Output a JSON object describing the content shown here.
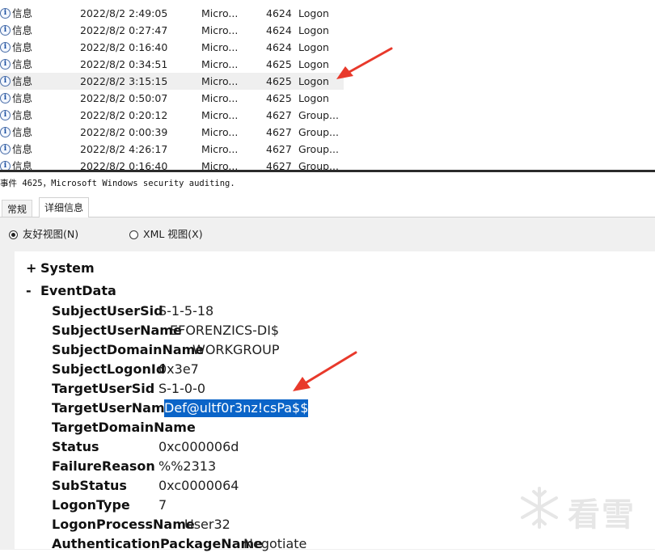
{
  "events": [
    {
      "level": "信息",
      "date": "2022/8/2 2:49:05",
      "source": "Micro...",
      "event_id": "4624",
      "task": "Logon"
    },
    {
      "level": "信息",
      "date": "2022/8/2 0:27:47",
      "source": "Micro...",
      "event_id": "4624",
      "task": "Logon"
    },
    {
      "level": "信息",
      "date": "2022/8/2 0:16:40",
      "source": "Micro...",
      "event_id": "4624",
      "task": "Logon"
    },
    {
      "level": "信息",
      "date": "2022/8/2 0:34:51",
      "source": "Micro...",
      "event_id": "4625",
      "task": "Logon"
    },
    {
      "level": "信息",
      "date": "2022/8/2 3:15:15",
      "source": "Micro...",
      "event_id": "4625",
      "task": "Logon",
      "selected": true
    },
    {
      "level": "信息",
      "date": "2022/8/2 0:50:07",
      "source": "Micro...",
      "event_id": "4625",
      "task": "Logon"
    },
    {
      "level": "信息",
      "date": "2022/8/2 0:20:12",
      "source": "Micro...",
      "event_id": "4627",
      "task": "Group..."
    },
    {
      "level": "信息",
      "date": "2022/8/2 0:00:39",
      "source": "Micro...",
      "event_id": "4627",
      "task": "Group..."
    },
    {
      "level": "信息",
      "date": "2022/8/2 4:26:17",
      "source": "Micro...",
      "event_id": "4627",
      "task": "Group..."
    },
    {
      "level": "信息",
      "date": "2022/8/2 0:16:40",
      "source": "Micro...",
      "event_id": "4627",
      "task": "Group..."
    }
  ],
  "info_icon_glyph": "i",
  "detail": {
    "title": "事件 4625，Microsoft Windows security auditing."
  },
  "tabs": {
    "general": "常规",
    "details": "详细信息"
  },
  "view_options": {
    "friendly": "友好视图(N)",
    "xml": "XML 视图(X)",
    "selected": "friendly"
  },
  "tree": {
    "system": {
      "toggle": "+",
      "label": "System"
    },
    "eventdata": {
      "toggle": "-",
      "label": "EventData"
    }
  },
  "event_data": [
    {
      "key": "SubjectUserSid",
      "value": "S-1-5-18"
    },
    {
      "key": "SubjectUserName",
      "value": "EFORENZICS-DI$"
    },
    {
      "key": "SubjectDomainName",
      "value": "WORKGROUP"
    },
    {
      "key": "SubjectLogonId",
      "value": "0x3e7"
    },
    {
      "key": "TargetUserSid",
      "value": "S-1-0-0"
    },
    {
      "key": "TargetUserName",
      "value": "Def@ultf0r3nz!csPa$$",
      "highlighted": true
    },
    {
      "key": "TargetDomainName",
      "value": ""
    },
    {
      "key": "Status",
      "value": "0xc000006d"
    },
    {
      "key": "FailureReason",
      "value": "%%2313"
    },
    {
      "key": "SubStatus",
      "value": "0xc0000064"
    },
    {
      "key": "LogonType",
      "value": "7"
    },
    {
      "key": "LogonProcessName",
      "value": "User32"
    },
    {
      "key": "AuthenticationPackageName",
      "value": "Negotiate"
    }
  ],
  "watermark": {
    "text": "看雪",
    "icon": "snowflake-icon"
  },
  "colors": {
    "selection": "#0a64c8",
    "annotation_arrow": "#e8392b",
    "selected_row": "#efefef"
  }
}
